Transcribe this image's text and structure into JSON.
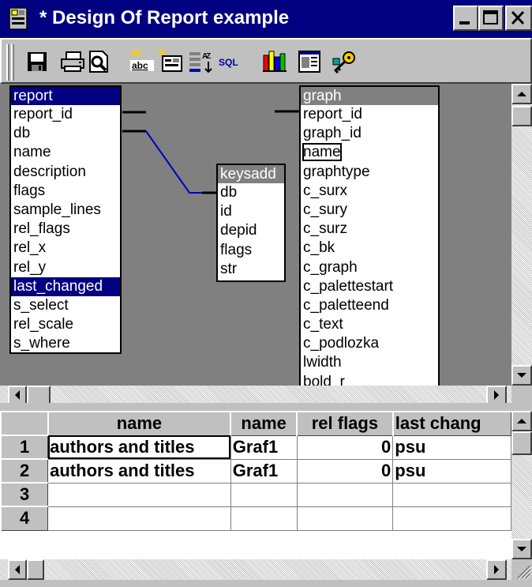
{
  "window": {
    "title": "* Design Of Report example",
    "icon": "report-app-icon"
  },
  "titlebar_buttons": [
    "minimize-icon",
    "maximize-icon",
    "close-icon"
  ],
  "toolbar": {
    "tools": [
      "save-icon",
      "print-icon",
      "print-preview-icon",
      "spell-abc-icon",
      "new-field-icon",
      "sort-az-icon",
      "sql-icon",
      "chart-icon",
      "form-icon",
      "key-icon"
    ],
    "sql_label": "SQL",
    "abc_label": "abc"
  },
  "tables": {
    "report": {
      "name": "report",
      "fields": [
        "report_id",
        "db",
        "name",
        "description",
        "flags",
        "sample_lines",
        "rel_flags",
        "rel_x",
        "rel_y",
        "last_changed",
        "s_select",
        "rel_scale",
        "s_where"
      ],
      "selected": "last_changed"
    },
    "keysadd": {
      "name": "keysadd",
      "fields": [
        "db",
        "id",
        "depid",
        "flags",
        "str"
      ]
    },
    "graph": {
      "name": "graph",
      "fields": [
        "report_id",
        "graph_id",
        "name",
        "graphtype",
        "c_surx",
        "c_sury",
        "c_surz",
        "c_bk",
        "c_graph",
        "c_palettestart",
        "c_paletteend",
        "c_text",
        "c_podlozka",
        "lwidth",
        "bold_r"
      ],
      "focused": "name"
    }
  },
  "grid": {
    "columns": [
      "name",
      "name",
      "rel  flags",
      "last  chang"
    ],
    "rows": [
      {
        "num": "1",
        "cells": [
          "authors and titles",
          "Graf1",
          "0",
          "psu"
        ]
      },
      {
        "num": "2",
        "cells": [
          "authors and titles",
          "Graf1",
          "0",
          "psu"
        ]
      },
      {
        "num": "3",
        "cells": [
          "",
          "",
          "",
          ""
        ]
      },
      {
        "num": "4",
        "cells": [
          "",
          "",
          "",
          ""
        ]
      }
    ]
  }
}
